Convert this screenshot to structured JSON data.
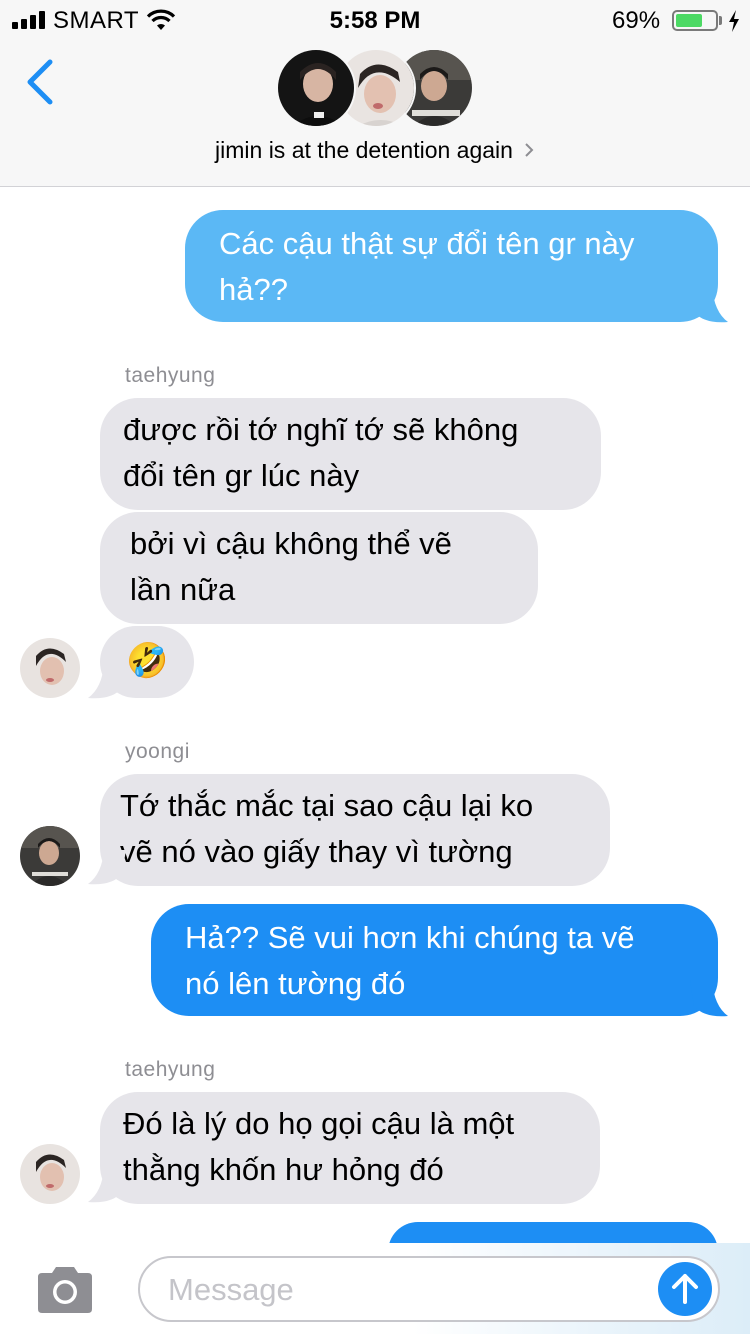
{
  "status_bar": {
    "carrier": "SMART",
    "time": "5:58 PM",
    "battery_percent": "69%",
    "battery_level": 0.69,
    "battery_color": "#4cd964"
  },
  "header": {
    "back_icon": "chevron-left-icon",
    "title": "jimin is at the detention again",
    "title_chevron_icon": "chevron-right-icon"
  },
  "colors": {
    "outgoing_bubble": "#1d8ef4",
    "outgoing_bubble_light": "#5bb8f5",
    "incoming_bubble": "#e6e5ea",
    "accent": "#1d8ef4"
  },
  "messages": [
    {
      "direction": "outgoing",
      "lines": [
        "Các cậu thật sự đổi tên gr này",
        "hả??"
      ]
    },
    {
      "direction": "incoming",
      "sender": "taehyung",
      "lines": [
        "được rồi tớ nghĩ tớ sẽ không",
        "đổi tên gr lúc này"
      ]
    },
    {
      "direction": "incoming",
      "lines": [
        "bởi vì cậu không thể vẽ",
        "lần nữa"
      ]
    },
    {
      "direction": "incoming",
      "lines": [
        "🤣"
      ]
    },
    {
      "direction": "incoming",
      "sender": "yoongi",
      "lines": [
        "Tớ thắc mắc tại sao cậu lại ko",
        "vẽ nó vào giấy thay vì tường"
      ]
    },
    {
      "direction": "outgoing",
      "lines": [
        "Hả?? Sẽ vui hơn khi chúng ta vẽ",
        "nó lên tường đó"
      ]
    },
    {
      "direction": "incoming",
      "sender": "taehyung",
      "lines": [
        "Đó là lý do họ gọi cậu là một",
        "thằng khốn hư hỏng đó"
      ]
    }
  ],
  "composer": {
    "camera_icon": "camera-icon",
    "placeholder": "Message",
    "send_icon": "arrow-up-icon"
  }
}
